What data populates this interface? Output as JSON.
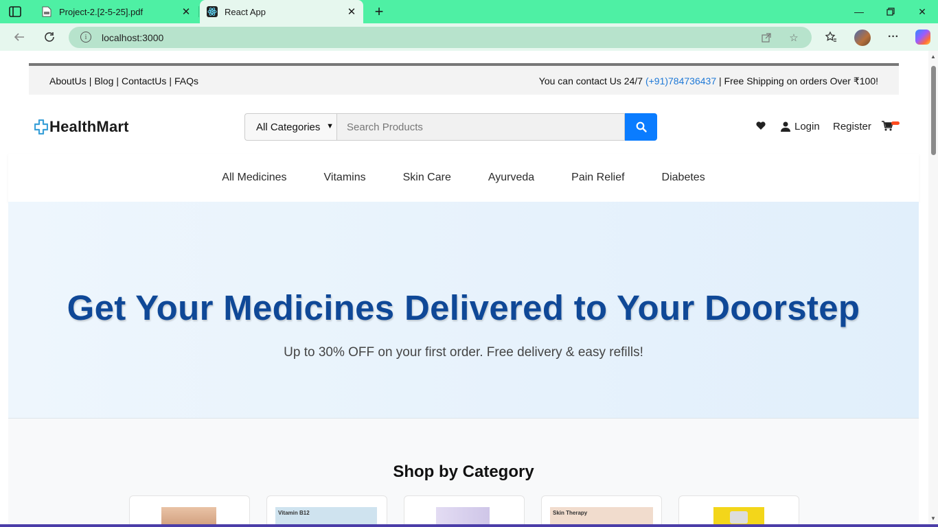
{
  "browser": {
    "tabs": [
      {
        "title": "Project-2.[2-5-25].pdf",
        "active": false
      },
      {
        "title": "React App",
        "active": true
      }
    ],
    "url": "localhost:3000",
    "accent": "#4ef0a4"
  },
  "topbar": {
    "links": [
      "AboutUs",
      "Blog",
      "ContactUs",
      "FAQs"
    ],
    "contact_prefix": "You can contact Us 24/7",
    "phone": "(+91)784736437",
    "shipping": "| Free Shipping on orders Over ₹100!"
  },
  "header": {
    "logo": "HealthMart",
    "category_select": "All Categories",
    "search_placeholder": "Search Products",
    "login": "Login",
    "register": "Register"
  },
  "nav": [
    "All Medicines",
    "Vitamins",
    "Skin Care",
    "Ayurveda",
    "Pain Relief",
    "Diabetes"
  ],
  "hero": {
    "title": "Get Your Medicines Delivered to Your Doorstep",
    "subtitle": "Up to 30% OFF on your first order. Free delivery & easy refills!"
  },
  "categories": {
    "heading": "Shop by Category",
    "cards": [
      {
        "thumb_text": ""
      },
      {
        "thumb_text": "Vitamin B12"
      },
      {
        "thumb_text": ""
      },
      {
        "thumb_text": "Skin Therapy"
      },
      {
        "thumb_text": ""
      }
    ]
  },
  "colors": {
    "primary_blue": "#0a7cff",
    "hero_title": "#0f4897",
    "phone_link": "#1e78d6"
  }
}
